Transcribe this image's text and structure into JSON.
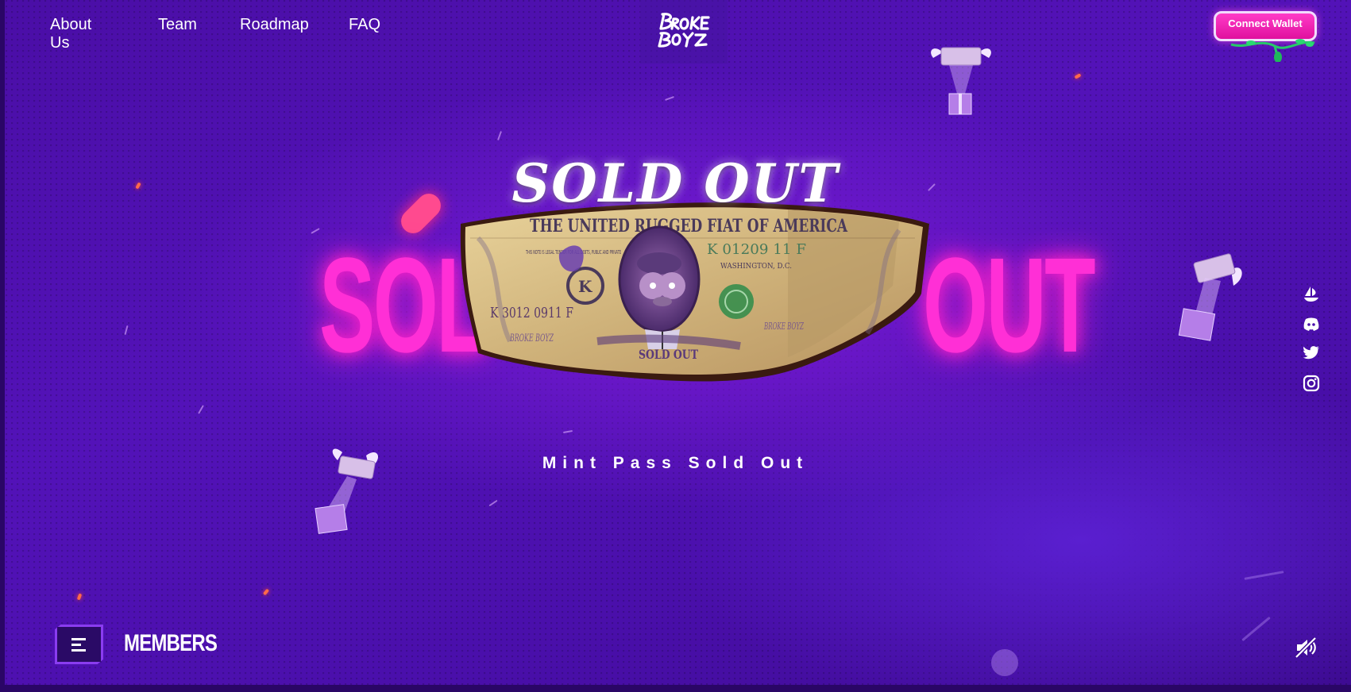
{
  "nav": {
    "items": [
      "About Us",
      "Team",
      "Roadmap",
      "FAQ"
    ]
  },
  "brand": {
    "logo_text": "BROKE BOYZ"
  },
  "header": {
    "connect_wallet": "Connect Wallet"
  },
  "hero": {
    "title": "SOLD OUT",
    "background_word_left": "SOL",
    "background_word_right": "OUT",
    "subtitle": "Mint Pass Sold Out",
    "bill_top_text": "THE UNITED RUGGED FIAT OF AMERICA",
    "bill_serial_right": "K 01209 11 F",
    "bill_serial_left": "K 3012 0911 F",
    "bill_city": "WASHINGTON, D.C.",
    "bill_bottom": "SOLD OUT",
    "bill_legal": "THIS NOTE IS LEGAL TENDER FOR ALL DEBTS, PUBLIC AND PRIVATE",
    "bill_seal_letter": "K",
    "bill_brand_small": "BROKE BOYZ"
  },
  "socials": [
    "opensea-icon",
    "discord-icon",
    "twitter-icon",
    "instagram-icon"
  ],
  "footer": {
    "members_label": "MEMBERS",
    "sound_icon": "sound-off-icon"
  },
  "colors": {
    "background": "#4d10ad",
    "accent_pink": "#ff2fd6",
    "wallet_button": "#ef1aae",
    "bill_paper": "#d9c28e"
  }
}
